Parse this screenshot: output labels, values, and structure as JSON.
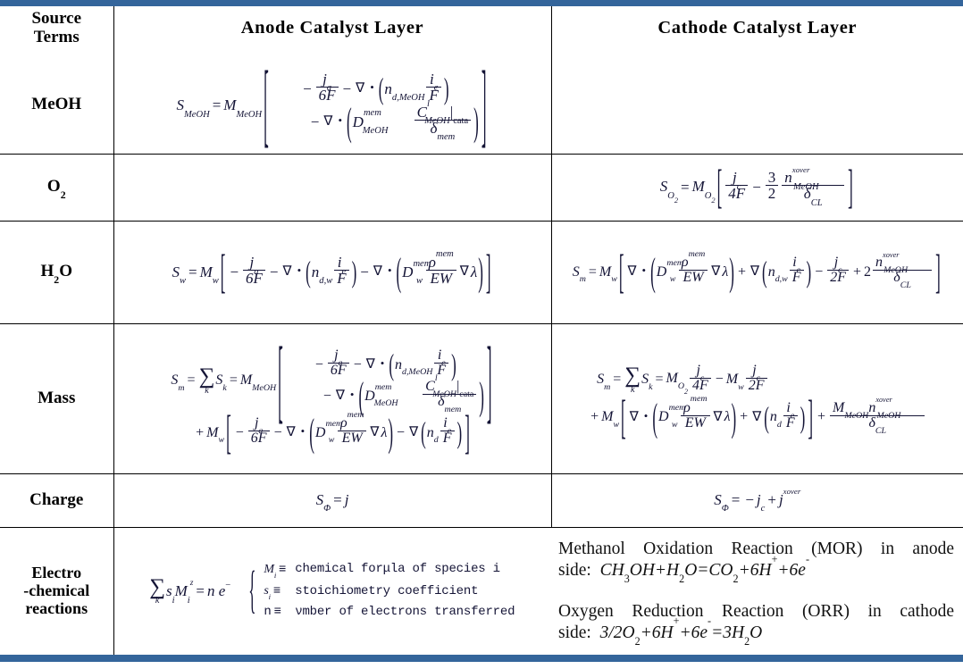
{
  "table": {
    "headers": {
      "col0": "Source\nTerms",
      "col0_line1": "Source",
      "col0_line2": "Terms",
      "col1": "Anode  Catalyst  Layer",
      "col2": "Cathode  Catalyst  Layer"
    },
    "row_labels": {
      "meoh": "MeOH",
      "o2": "O",
      "o2_sub": "2",
      "h2o_h": "H",
      "h2o_sub": "2",
      "h2o_o": "O",
      "mass": "Mass",
      "charge": "Charge",
      "electro_line1": "Electro",
      "electro_line2": "-chemical",
      "electro_line3": "reactions"
    },
    "formulas": {
      "meoh_anode": "S_MeOH = M_MeOH [ - j_a/(6F) - ∇ · ( n_d,MeOH i_e/F ) - ∇ · ( D^mem_MeOH C^l_MeOH|cata / δ_mem ) ]",
      "meoh_cathode": "",
      "o2_anode": "",
      "o2_cathode": "S_O2 = M_O2 [ j_c/(4F) - (3/2) n^xover_MeOH / δ_CL ]",
      "h2o_anode": "S_w = M_w [ - j_a/(6F) - ∇ · ( n_d,w i_e/F ) - ∇ · ( D^mem_w ρ^mem/EW ∇λ ) ]",
      "h2o_cathode": "S_m = M_w [ ∇ · ( D^mem_w ρ^mem/EW ∇λ ) + ∇ ( n_d,w i_e/F ) - j_c/(2F) + 2 n^xover_MeOH/δ_CL ]",
      "mass_anode": "S_m = Σ_k S_k = M_MeOH [ - j_a/(6F) - ∇ · ( n_d,MeOH i_e/F ) - ∇ · ( D^mem_MeOH C^l_MeOH|cata/δ_mem ) ] + M_w [ - j_a/(6F) - ∇ · ( D^mem_w ρ^mem/EW ∇λ ) - ∇ ( n_d i_e/F ) ]",
      "mass_cathode": "S_m = Σ_k S_k = M_O2 j_c/(4F) - M_w j_c/(2F) + M_w [ ∇ · ( D^mem_w ρ^mem/EW ∇λ ) + ∇ ( n_d i_e/F ) ] + M_MeOH n^xover_MeOH/δ_CL",
      "charge_anode": "S_Φ = j",
      "charge_cathode": "S_Φ = - j_c + j^xover",
      "electro_sum": "Σ_k s_i M_i^z = n e^-"
    },
    "symbols": {
      "S": "S",
      "M": "M",
      "j": "j",
      "F": "F",
      "i": "i",
      "n": "n",
      "D": "D",
      "C": "C",
      "E": "E",
      "W": "W",
      "rho": "ρ",
      "delta": "δ",
      "lambda": "λ",
      "nabla": "∇",
      "dot": "•",
      "sigma": "∑",
      "Phi": "Φ",
      "equiv": "≡",
      "mem": "mem",
      "cata": "cata",
      "xover": "xover",
      "CL": "CL",
      "MeOH": "MeOH",
      "w": "w",
      "k": "k",
      "a": "a",
      "c": "c",
      "e": "e",
      "d": "d",
      "l": "l",
      "m": "m",
      "z": "z",
      "s": "s"
    },
    "definitions": [
      {
        "sym": "M",
        "sub": "i",
        "eq": "≡",
        "text": "chemical forμla of species i"
      },
      {
        "sym": "s",
        "sub": "i",
        "eq": "≡",
        "text": "stoichiometry coefficient"
      },
      {
        "sym": "n",
        "sub": "",
        "eq": "≡",
        "text": "νmber of electrons transferred"
      }
    ],
    "reactions": [
      {
        "title": "Methanol Oxidation Reaction (MOR) in anode",
        "lead": "side:",
        "equation": "CH3OH+H2O=CO2+6H++6e-",
        "parts": [
          "CH",
          "3",
          "OH+H",
          "2",
          "O=CO",
          "2",
          "+6H",
          "+",
          "+6e",
          "-"
        ]
      },
      {
        "title": "Oxygen Reduction Reaction (ORR) in cathode",
        "lead": "side:",
        "equation": "3/2O2+6H++6e-=3H2O",
        "parts": [
          "3/2O",
          "2",
          "+6H",
          "+",
          "+6e",
          "-",
          "=3H",
          "2",
          "O"
        ]
      }
    ]
  },
  "colors": {
    "rule_blue": "#34659b",
    "border_black": "#000000",
    "math_ink": "#141436",
    "text_black": "#111111"
  }
}
